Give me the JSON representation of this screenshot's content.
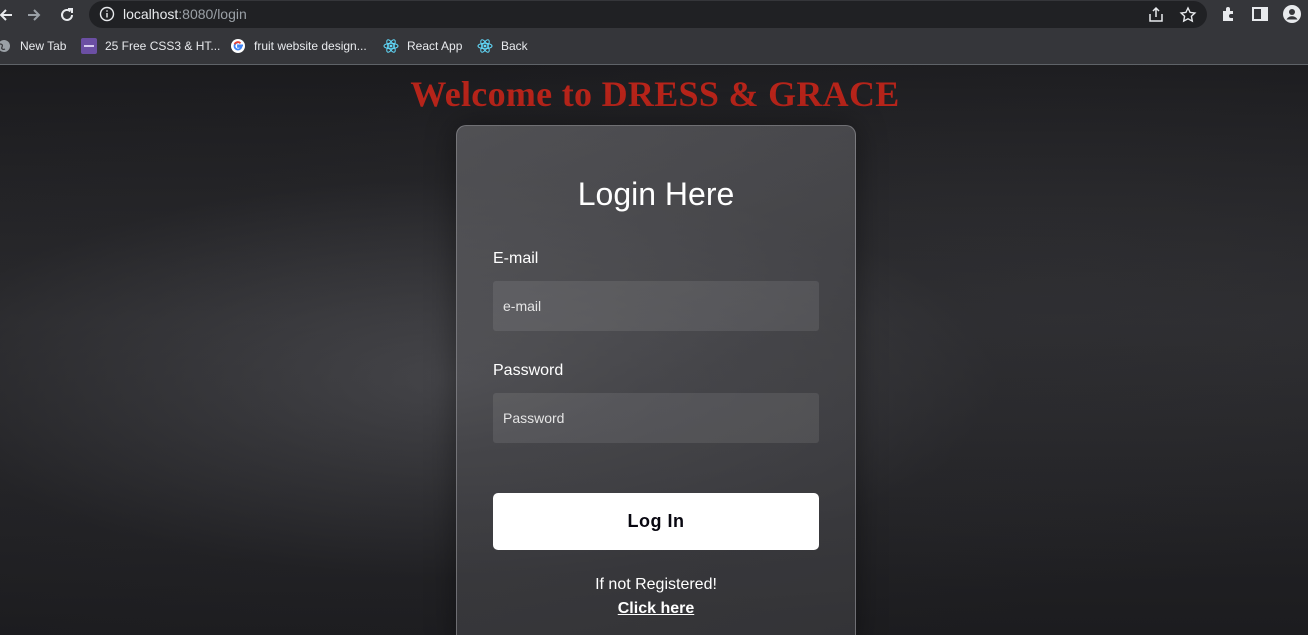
{
  "browser": {
    "url_host": "localhost",
    "url_rest": ":8080/login",
    "bookmarks": [
      {
        "label": "New Tab",
        "icon": "globe-icon"
      },
      {
        "label": "25 Free CSS3 & HT...",
        "icon": "colorlib-icon"
      },
      {
        "label": "fruit website design...",
        "icon": "google-icon"
      },
      {
        "label": "React App",
        "icon": "react-icon"
      },
      {
        "label": "Back",
        "icon": "react-icon"
      }
    ]
  },
  "page": {
    "welcome": "Welcome to DRESS & GRACE",
    "welcome_color": "#b6241a"
  },
  "form": {
    "title": "Login Here",
    "email_label": "E-mail",
    "email_placeholder": "e-mail",
    "email_value": "",
    "password_label": "Password",
    "password_placeholder": "Password",
    "password_value": "",
    "submit_label": "Log In",
    "register_prompt": "If not Registered!",
    "register_link": "Click here"
  }
}
